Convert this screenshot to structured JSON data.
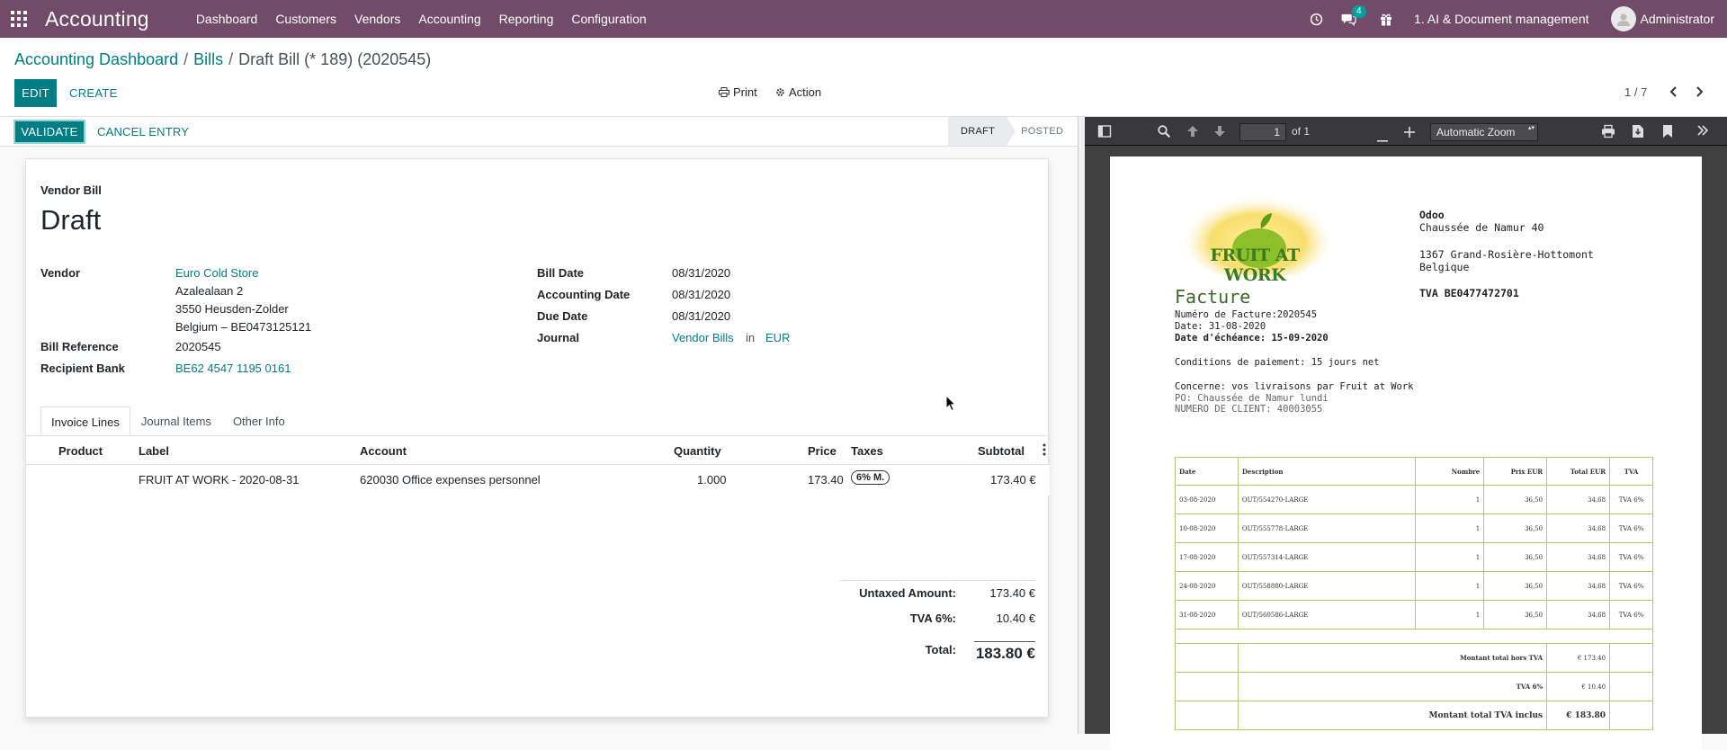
{
  "topbar": {
    "app_name": "Accounting",
    "menu": [
      "Dashboard",
      "Customers",
      "Vendors",
      "Accounting",
      "Reporting",
      "Configuration"
    ],
    "chat_badge": "4",
    "company": "1. AI & Document management",
    "user": "Administrator",
    "color": "#714b67"
  },
  "breadcrumb": {
    "item1": "Accounting Dashboard",
    "item2": "Bills",
    "current": "Draft Bill (* 189) (2020545)"
  },
  "buttons": {
    "edit": "EDIT",
    "create": "CREATE",
    "print": "Print",
    "action": "Action",
    "validate": "VALIDATE",
    "cancel_entry": "CANCEL ENTRY"
  },
  "pager": "1 / 7",
  "status": {
    "stages": [
      "DRAFT",
      "POSTED"
    ],
    "current": "DRAFT"
  },
  "form": {
    "type_label": "Vendor Bill",
    "title": "Draft",
    "vendor_label": "Vendor",
    "vendor_name": "Euro Cold Store",
    "vendor_address": [
      "Azalealaan 2",
      "3550 Heusden-Zolder",
      "Belgium – BE0473125121"
    ],
    "bill_reference_label": "Bill Reference",
    "bill_reference": "2020545",
    "recipient_bank_label": "Recipient Bank",
    "recipient_bank": "BE62 4547 1195 0161",
    "bill_date_label": "Bill Date",
    "bill_date": "08/31/2020",
    "accounting_date_label": "Accounting Date",
    "accounting_date": "08/31/2020",
    "due_date_label": "Due Date",
    "due_date": "08/31/2020",
    "journal_label": "Journal",
    "journal": "Vendor Bills",
    "journal_in": "in",
    "currency": "EUR"
  },
  "tabs": [
    "Invoice Lines",
    "Journal Items",
    "Other Info"
  ],
  "lines": {
    "headers": [
      "Product",
      "Label",
      "Account",
      "Quantity",
      "Price",
      "Taxes",
      "Subtotal"
    ],
    "rows": [
      {
        "product": "",
        "label": "FRUIT AT WORK - 2020-08-31",
        "account": "620030 Office expenses personnel",
        "quantity": "1.000",
        "price": "173.40",
        "taxes": "6% M.",
        "subtotal": "173.40 €"
      }
    ]
  },
  "totals": {
    "untaxed_label": "Untaxed Amount:",
    "untaxed": "173.40 €",
    "tax_label": "TVA 6%:",
    "tax": "10.40 €",
    "total_label": "Total:",
    "total": "183.80 €"
  },
  "pdf_viewer": {
    "page": "1",
    "of": "of 1",
    "zoom": "Automatic Zoom",
    "document": {
      "logo_text": "FRUIT AT WORK",
      "company_lines": [
        "Odoo",
        "Chaussée de Namur 40",
        "",
        "1367 Grand-Rosière-Hottomont",
        "Belgique"
      ],
      "tva": "TVA BE0477472701",
      "heading": "Facture",
      "numero": "Numéro de Facture:2020545",
      "date": "Date: 31-08-2020",
      "echeance": "Date d'échéance: 15-09-2020",
      "conditions": "Conditions de paiement: 15 jours net",
      "concerne": "Concerne: vos livraisons par Fruit at Work",
      "po": "PO: Chaussée de Namur lundi",
      "client": "NUMERO DE CLIENT: 40003055",
      "table_headers": [
        "Date",
        "Description",
        "Nombre",
        "Prix EUR",
        "Total EUR",
        "TVA"
      ],
      "table_rows": [
        [
          "03-08-2020",
          "OUT/554270-LARGE",
          "1",
          "36,50",
          "34,68",
          "TVA 6%"
        ],
        [
          "10-08-2020",
          "OUT/555778-LARGE",
          "1",
          "36,50",
          "34,68",
          "TVA 6%"
        ],
        [
          "17-08-2020",
          "OUT/557314-LARGE",
          "1",
          "36,50",
          "34,68",
          "TVA 6%"
        ],
        [
          "24-08-2020",
          "OUT/558880-LARGE",
          "1",
          "36,50",
          "34,68",
          "TVA 6%"
        ],
        [
          "31-08-2020",
          "OUT/560586-LARGE",
          "1",
          "36,50",
          "34,68",
          "TVA 6%"
        ]
      ],
      "sum_labels": [
        "Montant total hors TVA",
        "TVA 6%",
        "Montant total TVA inclus"
      ],
      "sum_values": [
        "€ 173.40",
        "€ 10.40",
        "€ 183.80"
      ]
    }
  }
}
